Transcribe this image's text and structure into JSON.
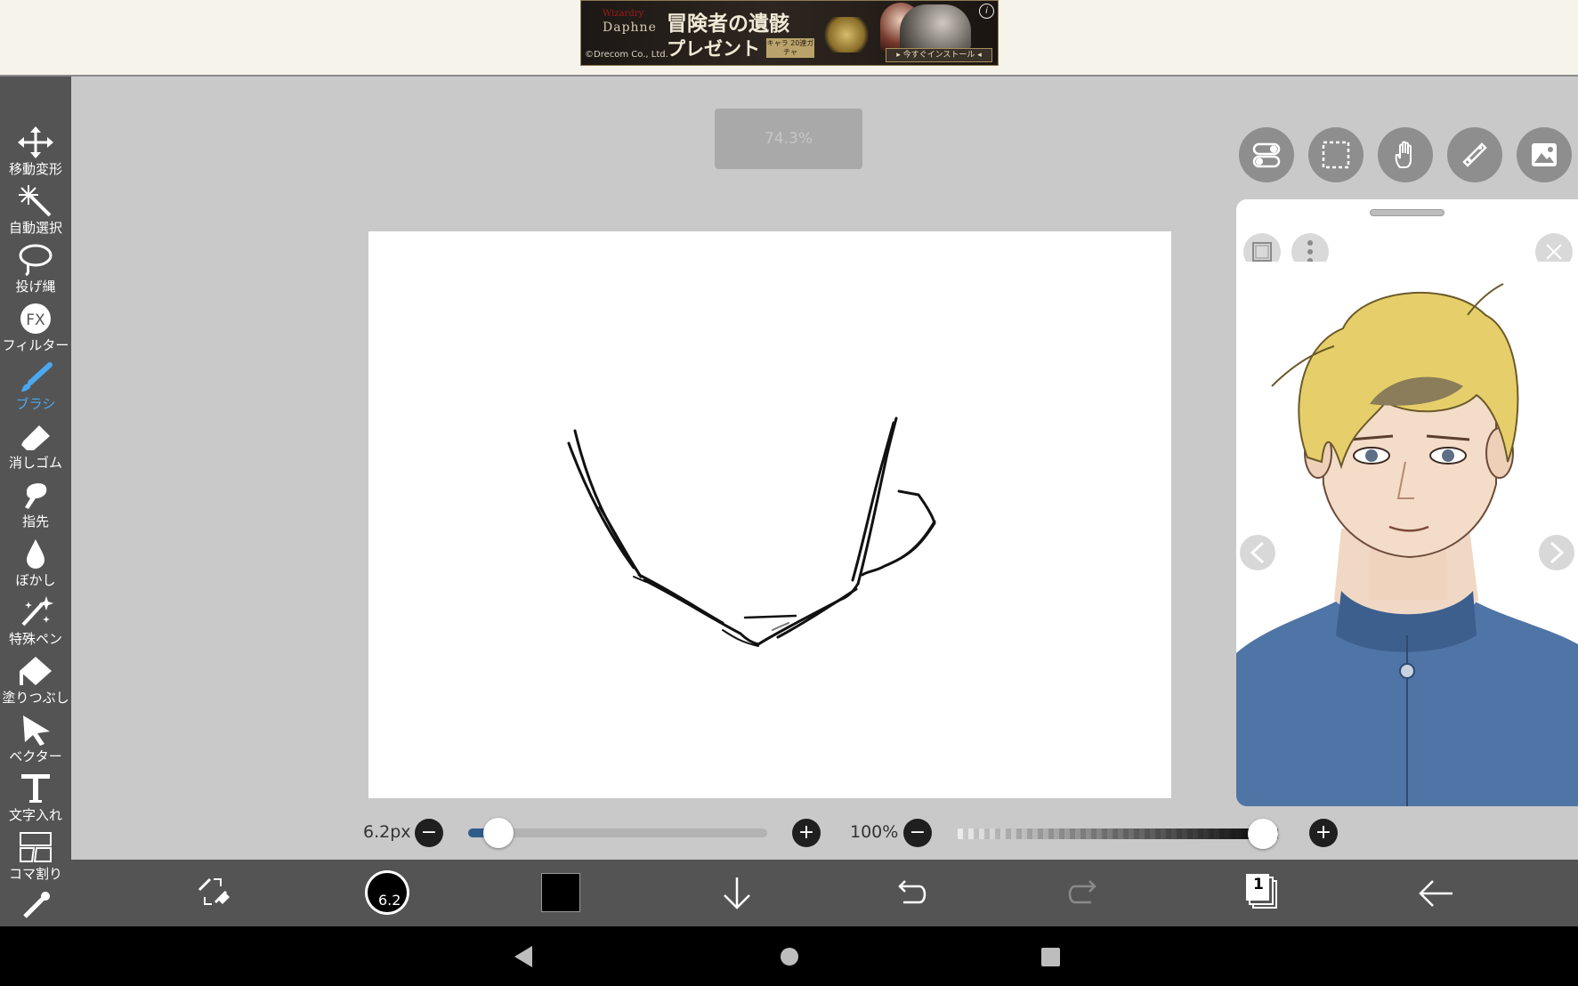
{
  "ad": {
    "brand_top": "Wizardry",
    "brand": "Daphne",
    "headline": "冒険者の遺骸",
    "sub": "プレゼント",
    "badge": "キャラ 20連ガチャ",
    "copyright": "©Drecom Co., Ltd.",
    "cta": "▸ 今すぐインストール ◂",
    "info": "i"
  },
  "tools": [
    {
      "label": "移動変形",
      "icon": "move-icon"
    },
    {
      "label": "自動選択",
      "icon": "magic-wand-icon"
    },
    {
      "label": "投げ縄",
      "icon": "lasso-icon"
    },
    {
      "label": "フィルター",
      "icon": "fx-icon"
    },
    {
      "label": "ブラシ",
      "icon": "brush-icon",
      "active": true
    },
    {
      "label": "消しゴム",
      "icon": "eraser-icon"
    },
    {
      "label": "指先",
      "icon": "finger-icon"
    },
    {
      "label": "ぼかし",
      "icon": "blur-drop-icon"
    },
    {
      "label": "特殊ペン",
      "icon": "special-pen-icon"
    },
    {
      "label": "塗りつぶし",
      "icon": "bucket-icon"
    },
    {
      "label": "ベクター",
      "icon": "vector-arrow-icon"
    },
    {
      "label": "文字入れ",
      "icon": "text-icon"
    },
    {
      "label": "コマ割り",
      "icon": "frame-divider-icon"
    }
  ],
  "zoom": "74.3%",
  "brush_size": {
    "label": "6.2px",
    "value": 6.2,
    "fraction": 0.1
  },
  "opacity": {
    "label": "100%",
    "fraction": 1.0
  },
  "brush_preview_label": "6.2",
  "layer_count": "1",
  "colors": {
    "primary": "#000000",
    "accent": "#4aa8f0",
    "toolbar": "#545454"
  }
}
